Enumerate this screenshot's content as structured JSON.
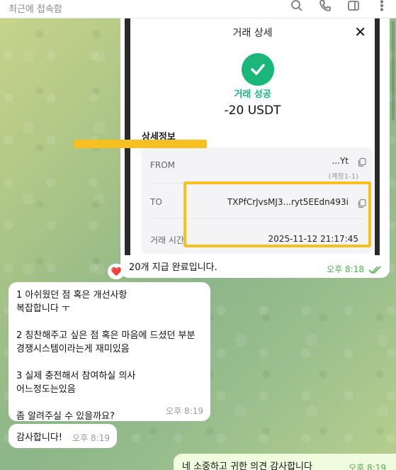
{
  "header": {
    "last_seen": "최근에 접속함",
    "icons": [
      "search-icon",
      "phone-icon",
      "sidebar-icon",
      "more-icon"
    ]
  },
  "receipt": {
    "title": "거래 상세",
    "status": "거래 성공",
    "amount": "-20 USDT",
    "section_title": "상세정보",
    "from_label": "FROM",
    "from_value_visible": "...Yt",
    "from_sub": "(계정1-1)",
    "to_label": "TO",
    "to_value": "TXPfCrJvsMJ3...ryt5EEdn493i",
    "time_label": "거래 시간",
    "time_value": "2025-11-12 21:17:45",
    "success_color": "#19b87a",
    "highlight_color": "#f6c021"
  },
  "messages": {
    "photo_caption": "20개 지급 완료입니다.",
    "photo_time": "오후 8:18",
    "reaction": "❤️",
    "incoming_1": {
      "text": "1 아쉬웠던 점 혹은 개선사항\n복잡합니다 ㅜ\n\n2 칭찬해주고 싶은 점 혹은 마음에 드셨던 부분\n경쟁시스템이라는게 재미있음\n\n3 실제 충전해서 참여하실 의사\n어느정도는있음\n\n좀 알려주실 수 있을까요?",
      "time": "오후 8:19"
    },
    "incoming_2": {
      "text": "감사합니다!",
      "time": "오후 8:19"
    },
    "outgoing_1": {
      "text": "네 소중하고 귀한 의견 감사합니다",
      "time": "오후 8:19"
    }
  }
}
